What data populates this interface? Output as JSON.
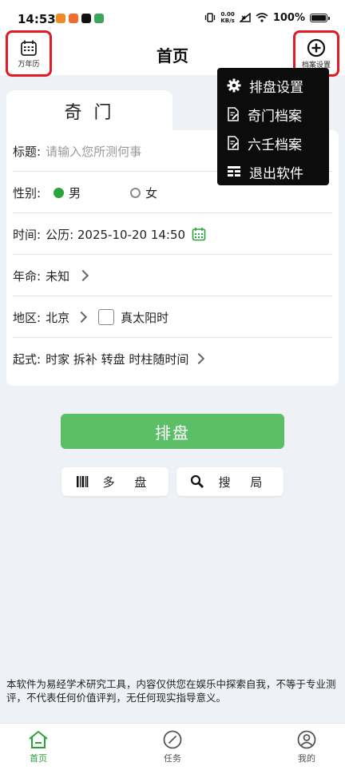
{
  "status": {
    "time": "14:53",
    "speed_top": "0.00",
    "speed_bottom": "KB/s",
    "battery": "100%"
  },
  "header": {
    "title": "首页",
    "left_label": "万年历",
    "right_label": "档案设置"
  },
  "menu": {
    "items": [
      "排盘设置",
      "奇门档案",
      "六壬档案",
      "退出软件"
    ]
  },
  "tab": {
    "label": "奇 门"
  },
  "form": {
    "title_label": "标题:",
    "title_placeholder": "请输入您所测何事",
    "gender_label": "性别:",
    "male": "男",
    "female": "女",
    "time_label": "时间:",
    "time_value": "公历: 2025-10-20 14:50",
    "life_label": "年命:",
    "life_value": "未知",
    "region_label": "地区:",
    "region_value": "北京",
    "solar_label": "真太阳时",
    "method_label": "起式:",
    "method_value": "时家 拆补 转盘 时柱随时间"
  },
  "actions": {
    "main": "排盘",
    "multi": "多 盘",
    "search": "搜 局"
  },
  "disclaimer": "本软件为易经学术研究工具，内容仅供您在娱乐中探索自我，不等于专业测评，不代表任何价值评判，无任何现实指导意义。",
  "nav": {
    "home": "首页",
    "task": "任务",
    "mine": "我的"
  },
  "colors": {
    "accent": "#5cbf67",
    "nav_active": "#2aa33b",
    "highlight_border": "#e01b24"
  }
}
